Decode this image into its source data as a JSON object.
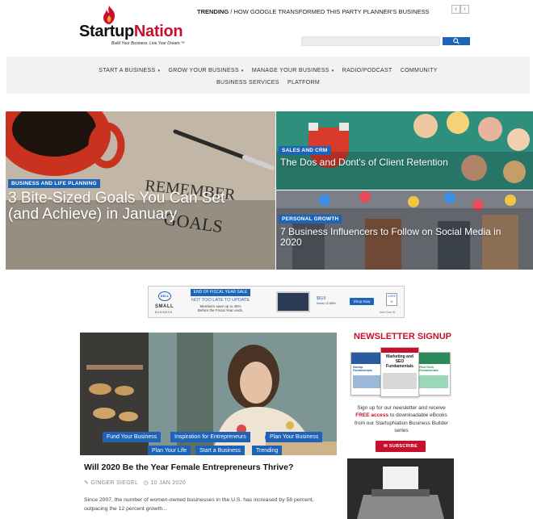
{
  "brand": {
    "name_part1": "Startup",
    "name_part2": "Nation",
    "tagline": "Build Your Business. Live Your Dream.™",
    "accent_color": "#c8102e"
  },
  "trending": {
    "label": "TRENDING",
    "separator": "/",
    "headline": "HOW GOOGLE TRANSFORMED THIS PARTY PLANNER'S BUSINESS",
    "prev": "‹",
    "next": "›"
  },
  "search": {
    "placeholder": "",
    "icon": "search-icon"
  },
  "nav": {
    "row1": [
      {
        "label": "START A BUSINESS",
        "dropdown": true
      },
      {
        "label": "GROW YOUR BUSINESS",
        "dropdown": true
      },
      {
        "label": "MANAGE YOUR BUSINESS",
        "dropdown": true
      },
      {
        "label": "RADIO/PODCAST",
        "dropdown": false
      },
      {
        "label": "COMMUNITY",
        "dropdown": false
      }
    ],
    "row2": [
      {
        "label": "BUSINESS SERVICES"
      },
      {
        "label": "PLATFORM"
      }
    ],
    "caret": "▾"
  },
  "hero": {
    "main": {
      "category": "BUSINESS AND LIFE PLANNING",
      "title_line1": "3 Bite-Sized Goals You Can Set",
      "title_line2": "(and Achieve) in January",
      "image_text_1": "REMEMBER",
      "image_text_2": "GOALS"
    },
    "top_right": {
      "category": "SALES AND CRM",
      "title": "The Dos and Dont's of Client Retention"
    },
    "bottom_right": {
      "category": "PERSONAL GROWTH",
      "title_line1": "7 Business Influencers to Follow on Social Media in",
      "title_line2": "2020"
    }
  },
  "ad": {
    "brand": "DELL",
    "small": "SMALL",
    "business": "BUSINESS",
    "headline": "END OF FISCAL YEAR SALE",
    "sub": "NOT TOO LATE TO UPDATE",
    "fine1": "Members save up to 45%",
    "fine2": "Before the Fiscal Year ends.",
    "price": "$619",
    "price_sub": "Vostro 15 5590",
    "cta": "Shop Now",
    "cpu": "CORE i5",
    "intel": "Intel Core i5"
  },
  "article": {
    "tags_row1": [
      "Fund Your Business",
      "Inspiration for Entrepreneurs",
      "Plan Your Business"
    ],
    "tags_row2": [
      "Plan Your Life",
      "Start a Business",
      "Trending"
    ],
    "title": "Will 2020 Be the Year Female Entrepreneurs Thrive?",
    "author": "GINGER SIEGEL",
    "date": "10 JAN 2020",
    "author_icon": "pencil-icon",
    "date_icon": "clock-icon",
    "excerpt": "Since 2007, the number of women-owned businesses in the U.S. has increased by 58 percent, outpacing the 12 percent growth..."
  },
  "newsletter": {
    "title": "NEWSLETTER SIGNUP",
    "book_center": "Marketing and SEO Fundamentals",
    "book_left": "Startup Fundamentals",
    "book_right": "Pitch Deck Fundamentals",
    "text_pre": "Sign up for our newsletter and receive",
    "text_red": "FREE access",
    "text_post": "to downloadable eBooks from our StartupNation Business Builder series",
    "button": "SUBSCRIBE",
    "button_icon": "envelope-icon"
  },
  "colors": {
    "link_blue": "#1e63b5",
    "brand_red": "#c8102e",
    "nav_bg": "#f2f2f2"
  }
}
